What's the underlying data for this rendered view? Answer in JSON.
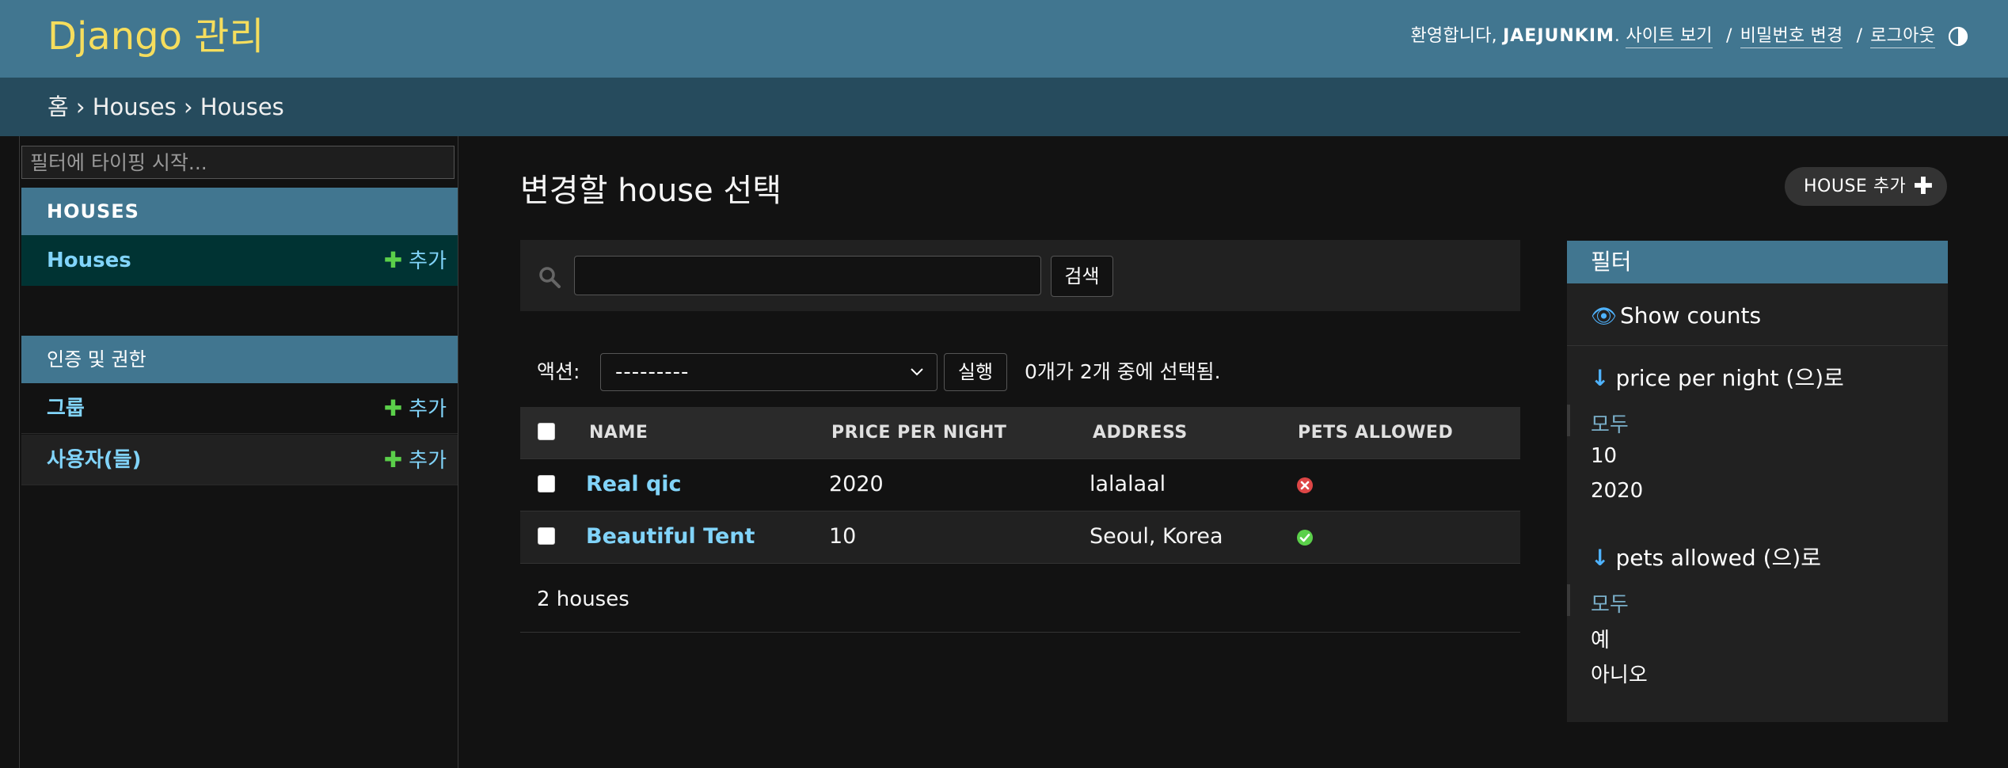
{
  "header": {
    "brand": "Django 관리",
    "welcome": "환영합니다,",
    "username": "JAEJUNKIM",
    "view_site": "사이트 보기",
    "change_password": "비밀번호 변경",
    "logout": "로그아웃",
    "separator": "/"
  },
  "breadcrumbs": {
    "home": "홈",
    "sep": "›",
    "app": "Houses",
    "model": "Houses"
  },
  "sidebar": {
    "filter_placeholder": "필터에 타이핑 시작...",
    "modules": [
      {
        "caption": "HOUSES",
        "models": [
          {
            "name": "Houses",
            "add": "추가"
          }
        ]
      },
      {
        "caption": "인증 및 권한",
        "models": [
          {
            "name": "그룹",
            "add": "추가"
          },
          {
            "name": "사용자(들)",
            "add": "추가"
          }
        ]
      }
    ]
  },
  "content": {
    "title": "변경할 house 선택",
    "add_button": "HOUSE 추가",
    "search_button": "검색",
    "search_value": "",
    "actions_label": "액션:",
    "action_selected": "---------",
    "go_button": "실행",
    "action_counter": "0개가 2개 중에 선택됨.",
    "columns": [
      "NAME",
      "PRICE PER NIGHT",
      "ADDRESS",
      "PETS ALLOWED"
    ],
    "rows": [
      {
        "name": "Real qic",
        "price": "2020",
        "address": "lalalaal",
        "pets_allowed": false
      },
      {
        "name": "Beautiful Tent",
        "price": "10",
        "address": "Seoul, Korea",
        "pets_allowed": true
      }
    ],
    "result_count": "2 houses"
  },
  "filter": {
    "title": "필터",
    "show_counts": "Show counts",
    "groups": [
      {
        "heading": "price per night (으)로",
        "options": [
          "모두",
          "10",
          "2020"
        ],
        "selected": "모두"
      },
      {
        "heading": "pets allowed (으)로",
        "options": [
          "모두",
          "예",
          "아니오"
        ],
        "selected": "모두"
      }
    ]
  },
  "colors": {
    "header_bg": "#417690",
    "brand": "#f5dd5d",
    "breadcrumb_bg": "#264b5d",
    "link": "#81d4fa",
    "add_plus": "#5bd04a",
    "yes_icon": "#5bd04a",
    "no_icon": "#dd4646"
  }
}
